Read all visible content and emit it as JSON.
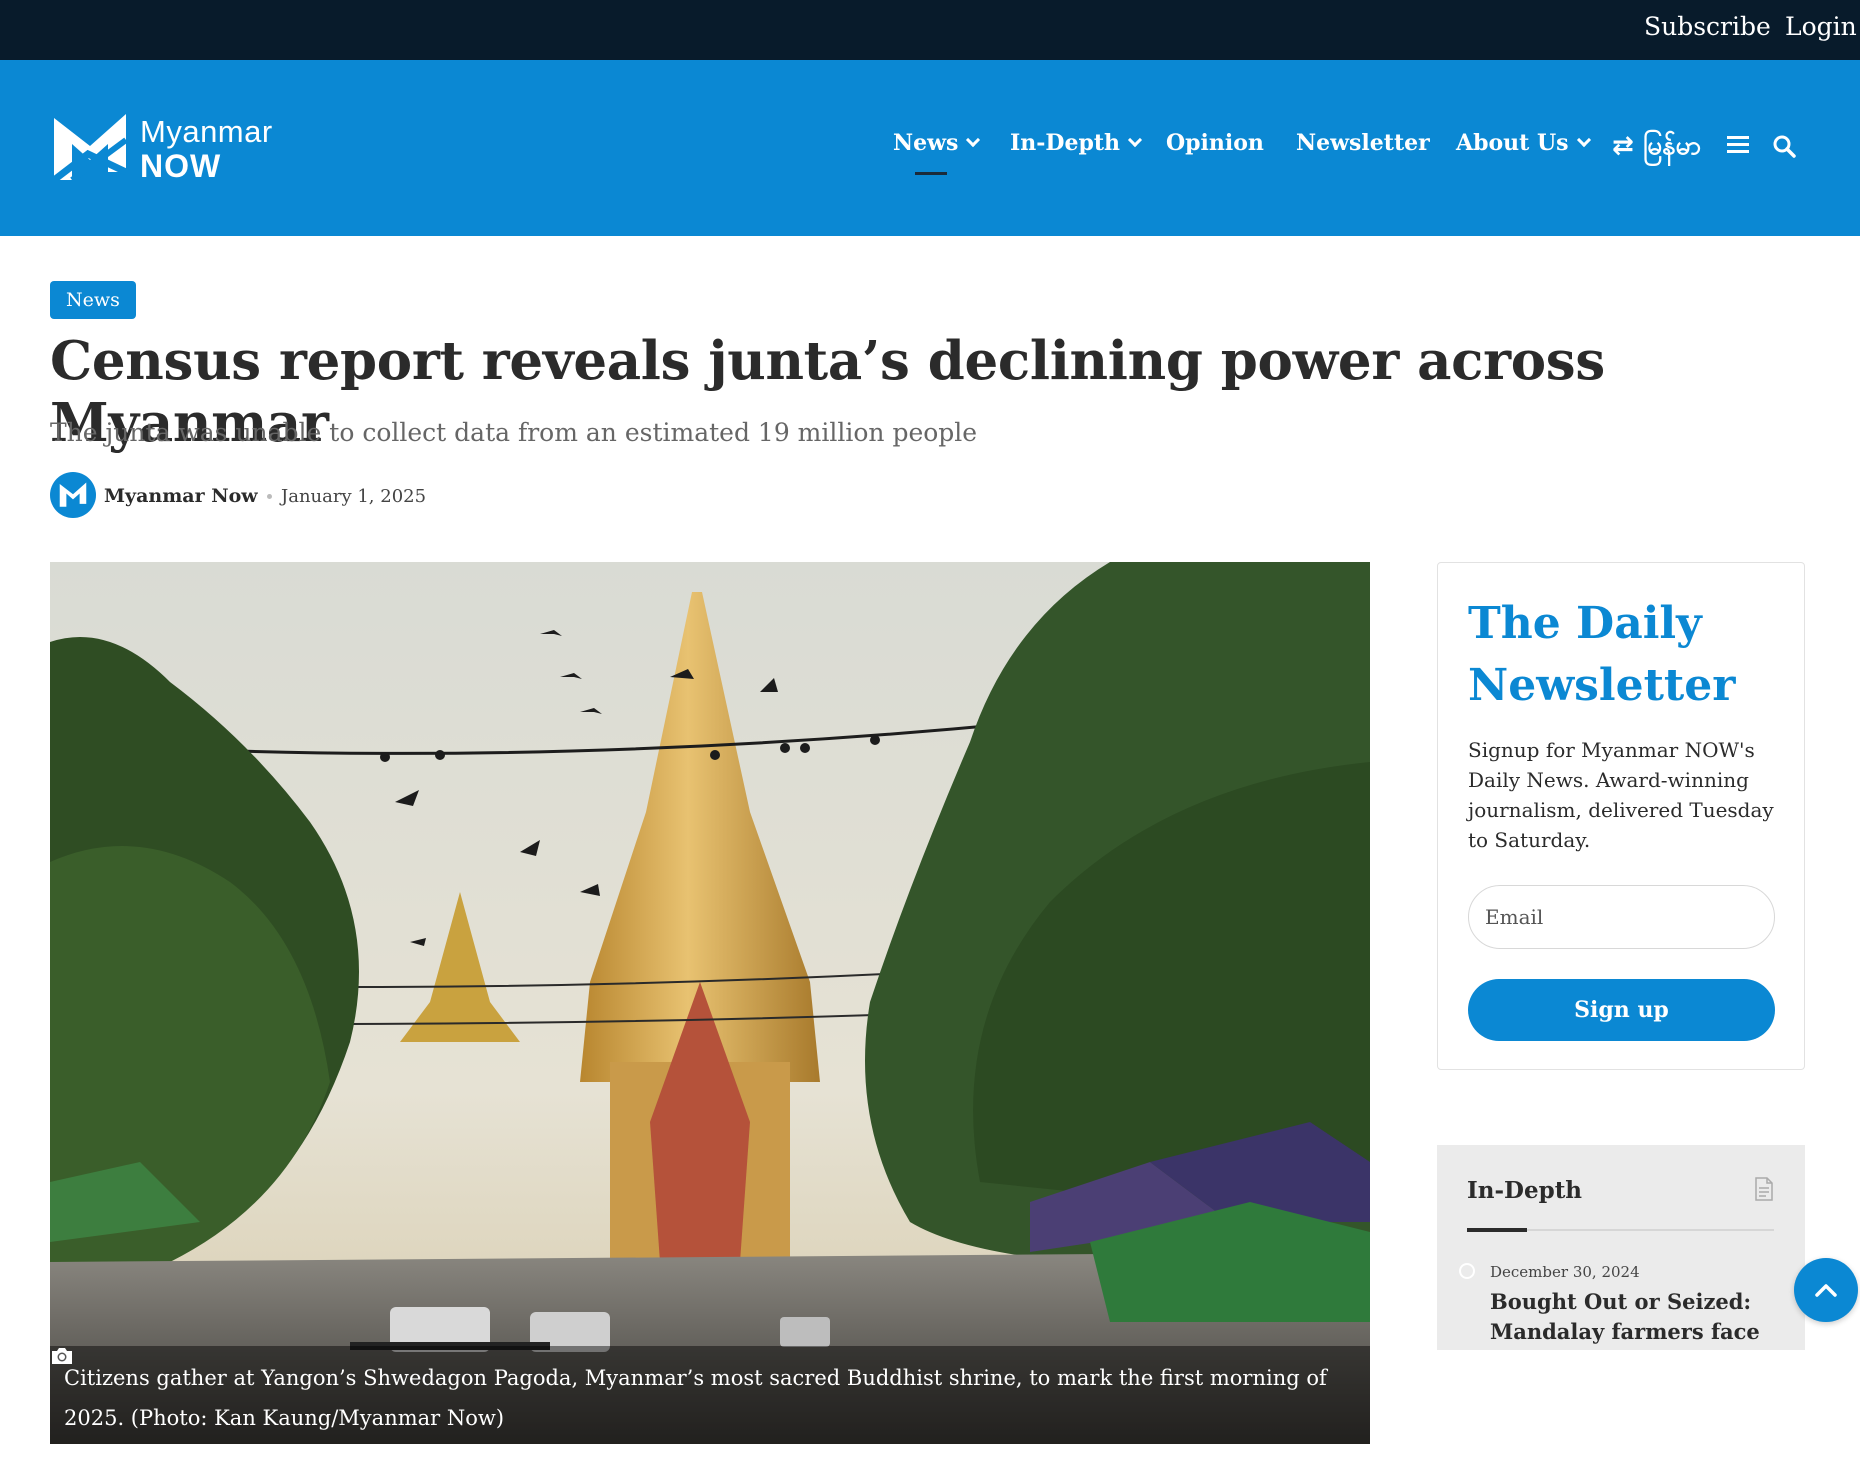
{
  "topbar": {
    "subscribe": "Subscribe",
    "login": "Login"
  },
  "brand": {
    "line1": "Myanmar",
    "line2": "NOW"
  },
  "nav": {
    "items": [
      {
        "label": "News",
        "has_dropdown": true,
        "active": true
      },
      {
        "label": "In-Depth",
        "has_dropdown": true
      },
      {
        "label": "Opinion",
        "has_dropdown": false
      },
      {
        "label": "Newsletter",
        "has_dropdown": false
      },
      {
        "label": "About Us",
        "has_dropdown": true
      }
    ],
    "language": "⇄ မြန်မာ",
    "icons": [
      "menu-icon",
      "search-icon"
    ]
  },
  "article": {
    "category": "News",
    "title": "Census report reveals junta’s declining power across Myanmar",
    "subtitle": "The junta was unable to collect data from an estimated 19 million people",
    "author": "Myanmar Now",
    "date": "January 1, 2025",
    "caption": "Citizens gather at Yangon’s Shwedagon Pagoda, Myanmar’s most sacred Buddhist shrine, to mark the first morning of 2025. (Photo: Kan Kaung/Myanmar Now)"
  },
  "newsletter": {
    "title": "The Daily Newsletter",
    "description": "Signup for Myanmar NOW's Daily News. Award-winning journalism, delivered Tuesday to Saturday.",
    "email_placeholder": "Email",
    "button": "Sign up"
  },
  "indepth": {
    "title": "In-Depth",
    "items": [
      {
        "date": "December 30, 2024",
        "headline": "Bought Out or Seized: Mandalay farmers face"
      }
    ]
  },
  "colors": {
    "brand_blue": "#0b88d3",
    "topbar": "#081b2b"
  }
}
